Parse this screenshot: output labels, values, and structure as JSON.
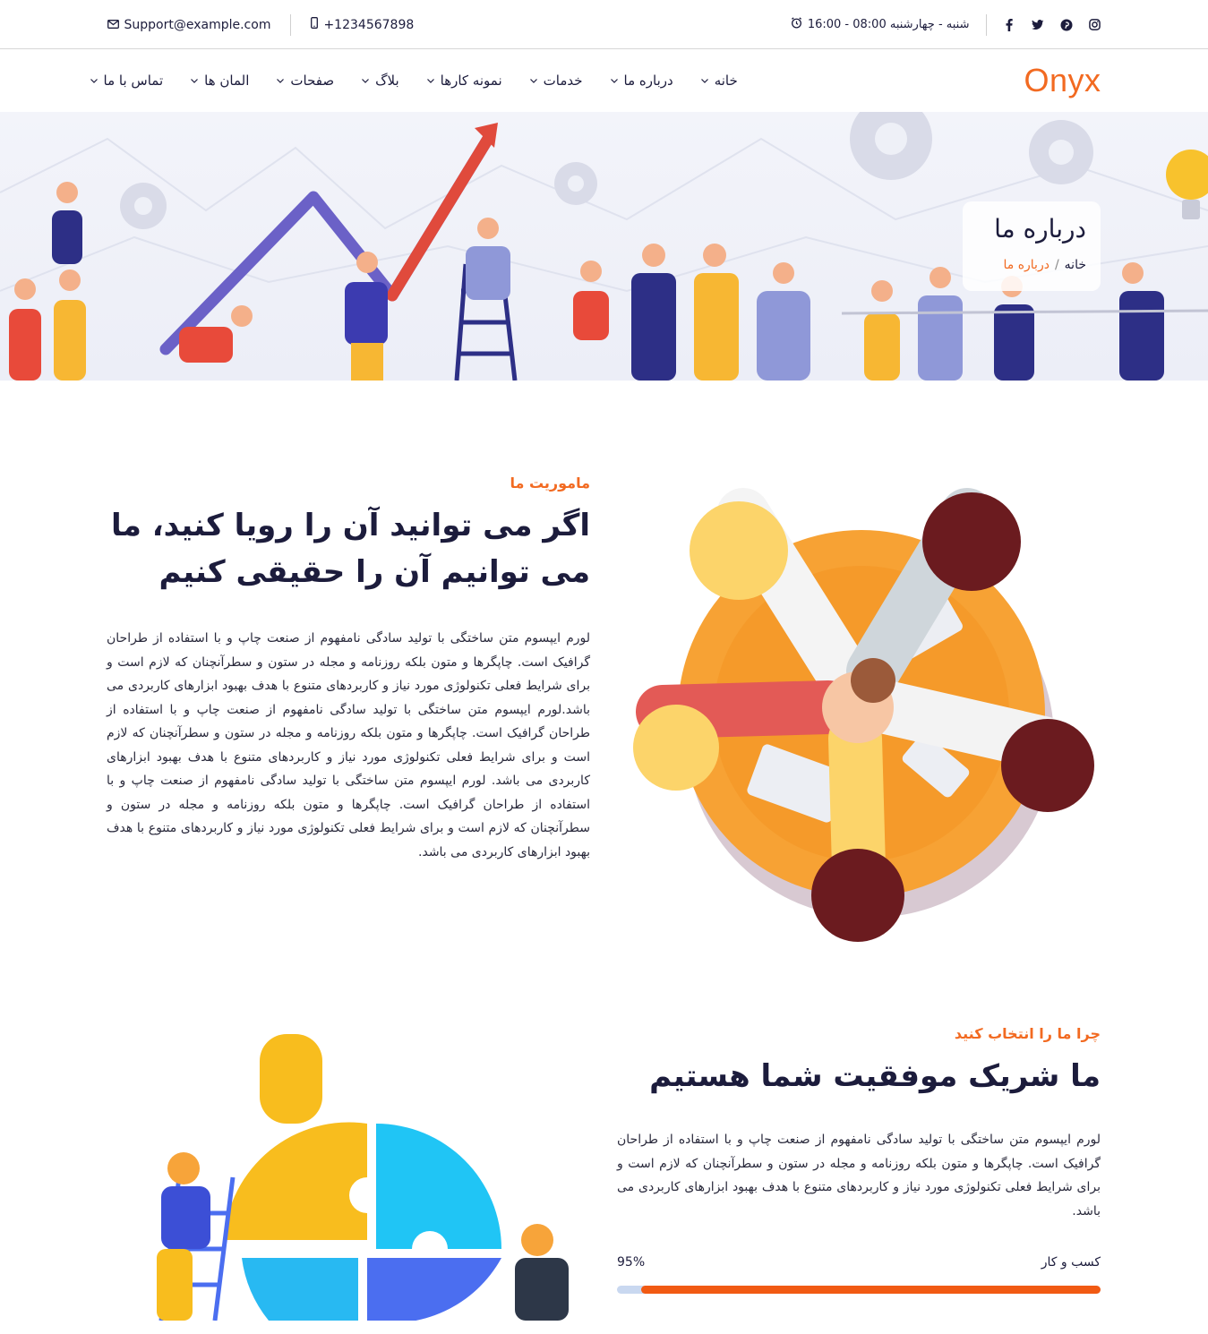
{
  "topbar": {
    "email": "Support@example.com",
    "phone": "+1234567898",
    "hours": "شنبه - چهارشنبه 08:00 - 16:00",
    "social": [
      "instagram-icon",
      "pinterest-icon",
      "twitter-icon",
      "facebook-icon"
    ]
  },
  "brand": {
    "logo": "Onyx",
    "accent": "#f26a21"
  },
  "nav": {
    "items": [
      {
        "label": "خانه"
      },
      {
        "label": "درباره ما"
      },
      {
        "label": "خدمات"
      },
      {
        "label": "نمونه کارها"
      },
      {
        "label": "بلاگ"
      },
      {
        "label": "صفحات"
      },
      {
        "label": "المان ها"
      },
      {
        "label": "تماس با ما"
      }
    ]
  },
  "hero": {
    "title": "درباره ما",
    "breadcrumb_home": "خانه",
    "breadcrumb_sep": "/",
    "breadcrumb_current": "درباره ما"
  },
  "mission": {
    "eyebrow": "ماموریت ما",
    "heading": "اگر می توانید آن را رویا کنید، ما می توانیم آن را حقیقی کنیم",
    "body": "لورم ایپسوم متن ساختگی با تولید سادگی نامفهوم از صنعت چاپ و با استفاده از طراحان گرافیک است. چاپگرها و متون بلکه روزنامه و مجله در ستون و سطرآنچنان که لازم است و برای شرایط فعلی تکنولوژی مورد نیاز و کاربردهای متنوع با هدف بهبود ابزارهای کاربردی می باشد.لورم ایپسوم متن ساختگی با تولید سادگی نامفهوم از صنعت چاپ و با استفاده از طراحان گرافیک است. چاپگرها و متون بلکه روزنامه و مجله در ستون و سطرآنچنان که لازم است و برای شرایط فعلی تکنولوژی مورد نیاز و کاربردهای متنوع با هدف بهبود ابزارهای کاربردی می باشد. لورم ایپسوم متن ساختگی با تولید سادگی نامفهوم از صنعت چاپ و با استفاده از طراحان گرافیک است. چاپگرها و متون بلکه روزنامه و مجله در ستون و سطرآنچنان که لازم است و برای شرایط فعلی تکنولوژی مورد نیاز و کاربردهای متنوع با هدف بهبود ابزارهای کاربردی می باشد."
  },
  "why": {
    "eyebrow": "چرا ما را انتخاب کنید",
    "heading": "ما شریک موفقیت شما هستیم",
    "body": "لورم ایپسوم متن ساختگی با تولید سادگی نامفهوم از صنعت چاپ و با استفاده از طراحان گرافیک است. چاپگرها و متون بلکه روزنامه و مجله در ستون و سطرآنچنان که لازم است و برای شرایط فعلی تکنولوژی مورد نیاز و کاربردهای متنوع با هدف بهبود ابزارهای کاربردی می باشد.",
    "progress": {
      "label": "کسب و کار",
      "value_text": "95%",
      "value": 95,
      "fill_color": "#f15a13",
      "track_color": "#c9d8f0"
    }
  }
}
